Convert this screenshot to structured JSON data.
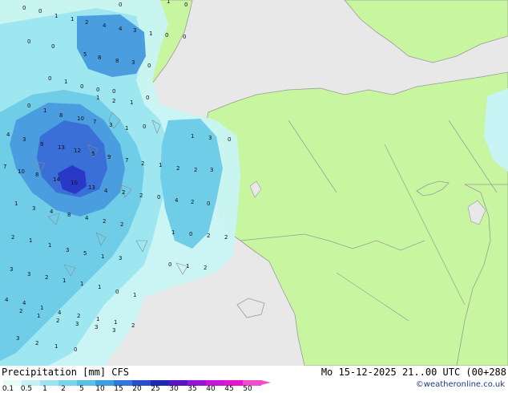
{
  "header": {
    "title": "Precipitation [mm]",
    "model": "CFS",
    "valid_time": "Mo 15-12-2025 21..00 UTC (00+288",
    "credit": "©weatheronline.co.uk"
  },
  "legend": {
    "labels": [
      "0.1",
      "0.5",
      "1",
      "2",
      "5",
      "10",
      "15",
      "20",
      "25",
      "30",
      "35",
      "40",
      "45",
      "50"
    ],
    "colors": [
      "#e6fafa",
      "#c4f0f5",
      "#9ee4f0",
      "#7ad4ee",
      "#5ac0e8",
      "#3c9fe0",
      "#3278dc",
      "#2850cc",
      "#1c2ab4",
      "#5a14c8",
      "#9614d8",
      "#c814d8",
      "#e614d0",
      "#f04cd0"
    ]
  },
  "map": {
    "colors": {
      "sea": "#e8e8e8",
      "land": "#c8f5a0",
      "border": "#9a9a9a",
      "precip_light": "#c9f4f6",
      "precip_low": "#9ee6f0",
      "precip_mid": "#6fcde8",
      "precip_high": "#4a9ee0",
      "precip_heavy": "#3a6fd8",
      "precip_max": "#2a38c8"
    },
    "values": [
      "0",
      "0",
      "1",
      "1",
      "0",
      "1",
      "0",
      "2",
      "4",
      "4",
      "3",
      "1",
      "0",
      "0",
      "5",
      "8",
      "8",
      "3",
      "0",
      "0",
      "0",
      "0",
      "1",
      "0",
      "0",
      "0",
      "1",
      "2",
      "1",
      "0",
      "0",
      "1",
      "8",
      "10",
      "7",
      "3",
      "1",
      "0",
      "4",
      "3",
      "8",
      "13",
      "12",
      "5",
      "9",
      "7",
      "2",
      "1",
      "7",
      "10",
      "8",
      "14",
      "10",
      "13",
      "4",
      "2",
      "2",
      "0",
      "2",
      "2",
      "3",
      "1",
      "3",
      "0",
      "1",
      "3",
      "4",
      "8",
      "4",
      "2",
      "2",
      "4",
      "2",
      "0",
      "2",
      "1",
      "1",
      "3",
      "5",
      "1",
      "3",
      "1",
      "0",
      "2",
      "2",
      "3",
      "3",
      "2",
      "1",
      "1",
      "1",
      "0",
      "1",
      "0",
      "1",
      "2",
      "2",
      "1",
      "2",
      "3",
      "3",
      "3",
      "4",
      "4",
      "1",
      "4",
      "2",
      "1",
      "1",
      "2",
      "3",
      "2",
      "1",
      "0"
    ]
  }
}
